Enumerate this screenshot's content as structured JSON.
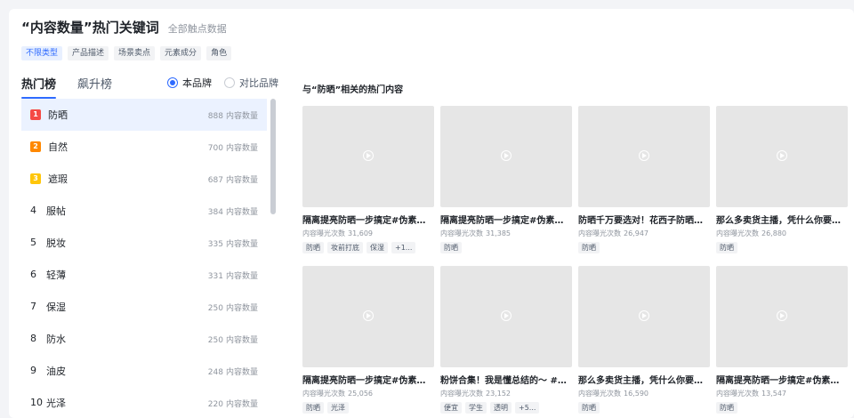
{
  "header": {
    "title": "“内容数量”热门关键词",
    "subtitle": "全部触点数据"
  },
  "filters": [
    {
      "label": "不限类型",
      "active": true
    },
    {
      "label": "产品描述",
      "active": false
    },
    {
      "label": "场景卖点",
      "active": false
    },
    {
      "label": "元素成分",
      "active": false
    },
    {
      "label": "角色",
      "active": false
    }
  ],
  "tabs": [
    {
      "label": "热门榜",
      "active": true
    },
    {
      "label": "飙升榜",
      "active": false
    }
  ],
  "radios": [
    {
      "label": "本品牌",
      "checked": true
    },
    {
      "label": "对比品牌",
      "checked": false
    }
  ],
  "count_unit": "内容数量",
  "keywords": [
    {
      "rank": "1",
      "word": "防晒",
      "count": "888"
    },
    {
      "rank": "2",
      "word": "自然",
      "count": "700"
    },
    {
      "rank": "3",
      "word": "遮瑕",
      "count": "687"
    },
    {
      "rank": "4",
      "word": "服帖",
      "count": "384"
    },
    {
      "rank": "5",
      "word": "脱妆",
      "count": "335"
    },
    {
      "rank": "6",
      "word": "轻薄",
      "count": "331"
    },
    {
      "rank": "7",
      "word": "保湿",
      "count": "250"
    },
    {
      "rank": "8",
      "word": "防水",
      "count": "250"
    },
    {
      "rank": "9",
      "word": "油皮",
      "count": "248"
    },
    {
      "rank": "10",
      "word": "光泽",
      "count": "220"
    }
  ],
  "content": {
    "section_title": "与“防晒”相关的热门内容",
    "exposure_label": "内容曝光次数",
    "items": [
      {
        "title": "隔离提亮防晒一步搞定#伪素颜…",
        "exposure": "31,609",
        "tags": [
          "防晒",
          "妆前打底",
          "保湿",
          "+1..."
        ]
      },
      {
        "title": "隔离提亮防晒一步搞定#伪素颜…",
        "exposure": "31,385",
        "tags": [
          "防晒"
        ]
      },
      {
        "title": "防晒千万要选对！花西子防晒…",
        "exposure": "26,947",
        "tags": [
          "防晒"
        ]
      },
      {
        "title": "那么多卖货主播，凭什么你要…",
        "exposure": "26,880",
        "tags": [
          "防晒"
        ]
      },
      {
        "title": "隔离提亮防晒一步搞定#伪素颜…",
        "exposure": "25,056",
        "tags": [
          "防晒",
          "光泽"
        ]
      },
      {
        "title": "粉饼合集！我是懂总结的～ #…",
        "exposure": "23,152",
        "tags": [
          "便宜",
          "学生",
          "透明",
          "+5..."
        ]
      },
      {
        "title": "那么多卖货主播，凭什么你要…",
        "exposure": "16,590",
        "tags": [
          "防晒"
        ]
      },
      {
        "title": "隔离提亮防晒一步搞定#伪素颜…",
        "exposure": "13,547",
        "tags": [
          "防晒"
        ]
      }
    ]
  }
}
